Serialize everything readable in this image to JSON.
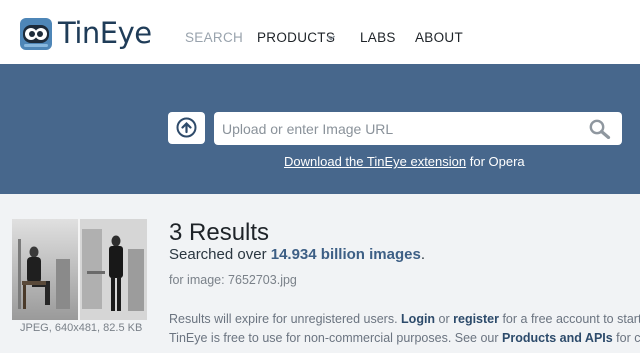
{
  "header": {
    "logo_text": "TinEye",
    "nav": [
      {
        "label": "SEARCH",
        "active": true
      },
      {
        "label": "PRODUCTS",
        "active": false
      },
      {
        "label": "LABS",
        "active": false
      },
      {
        "label": "ABOUT",
        "active": false
      }
    ]
  },
  "search": {
    "placeholder": "Upload or enter Image URL",
    "extension_link": "Download the TinEye extension",
    "extension_suffix": " for Opera"
  },
  "results": {
    "title": "3 Results",
    "searched_prefix": "Searched over ",
    "searched_count": "14.934 billion images",
    "searched_suffix": ".",
    "for_image": "for image: 7652703.jpg",
    "thumb_caption": "JPEG, 640x481, 82.5 KB",
    "note1_prefix": "Results will expire for unregistered users. ",
    "note1_login": "Login",
    "note1_or": " or ",
    "note1_register": "register",
    "note1_suffix": " for a free account to start sav",
    "note2_prefix": "TinEye is free to use for non-commercial purposes. See our ",
    "note2_link": "Products and APIs",
    "note2_suffix": " for comm"
  },
  "colors": {
    "band": "#47678c",
    "results_bg": "#f1f3f5",
    "accent": "#3d5f85",
    "logo_navy": "#1f3c58"
  },
  "icons": [
    "tineye-logo-icon",
    "chevron-down-icon",
    "upload-arrow-icon",
    "search-icon"
  ]
}
